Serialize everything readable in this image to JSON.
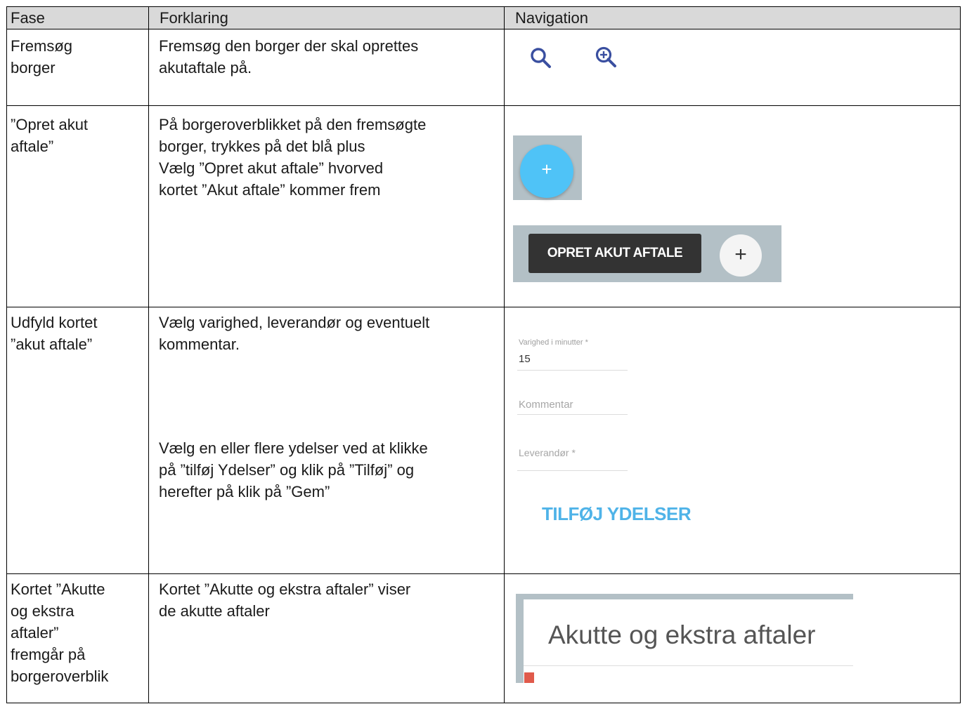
{
  "header": {
    "col1": "Fase",
    "col2": "Forklaring",
    "col3": "Navigation"
  },
  "rows": [
    {
      "fase": "Fremsøg\nborger",
      "forklaring": "Fremsøg den borger der skal oprettes\nakutaftale på."
    },
    {
      "fase": "”Opret akut\naftale”",
      "forklaring": "På borgeroverblikket på den fremsøgte\nborger, trykkes på det blå plus\nVælg  ”Opret akut aftale” hvorved\nkortet ”Akut aftale” kommer frem"
    },
    {
      "fase": "Udfyld kortet\n”akut aftale”",
      "forklaring": "Vælg varighed, leverandør og eventuelt\nkommentar.",
      "forklaring2": "Vælg en eller flere ydelser ved at klikke\npå ”tilføj Ydelser” og klik på ”Tilføj” og\nherefter på klik på ”Gem”"
    },
    {
      "fase": "Kortet ”Akutte\nog ekstra\naftaler”\nfremgår på\nborgeroverblik",
      "forklaring": "Kortet ”Akutte og ekstra aftaler” viser\nde akutte aftaler"
    }
  ],
  "nav": {
    "fab_plus": "+",
    "opret_button": "OPRET AKUT AFTALE",
    "opret_plus": "+",
    "form": {
      "varighed_label": "Varighed i minutter *",
      "varighed_value": "15",
      "kommentar_placeholder": "Kommentar",
      "leverandor_placeholder": "Leverandør *",
      "tilfoj_button": "TILFØJ YDELSER"
    },
    "card_title": "Akutte og ekstra aftaler"
  },
  "colors": {
    "header_bg": "#d9d9d9",
    "icon_blue": "#3a4fa0",
    "fab_blue": "#4fc3f7",
    "panel_grey": "#b3c0c6",
    "tilfoj_blue": "#4fb3e8",
    "accent_red": "#e05a4b"
  },
  "icons": [
    "search-icon",
    "zoom-in-icon",
    "plus-icon"
  ]
}
